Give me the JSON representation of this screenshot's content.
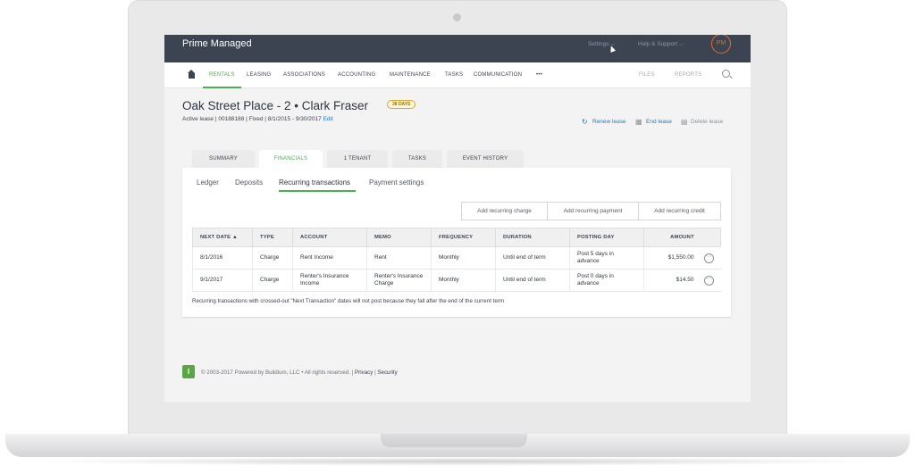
{
  "app": {
    "brand": "Prime Managed",
    "avatar_initials": "PM"
  },
  "topmenu": {
    "settings": "Settings",
    "help": "Help & Support",
    "chevron": "⌵"
  },
  "nav": {
    "items": [
      "RENTALS",
      "LEASING",
      "ASSOCIATIONS",
      "ACCOUNTING",
      "MAINTENANCE",
      "TASKS",
      "COMMUNICATION",
      "•••"
    ],
    "right": [
      "FILES",
      "REPORTS"
    ]
  },
  "lease": {
    "title": "Oak Street Place - 2 • Clark Fraser",
    "days_badge": "38 DAYS",
    "subtitle": "Active lease | 00188188 | Fixed | 8/1/2015 - 9/30/2017",
    "edit": "Edit",
    "actions": {
      "renew": "Renew lease",
      "end": "End lease",
      "delete": "Delete lease"
    }
  },
  "tabs": [
    "SUMMARY",
    "FINANCIALS",
    "1 TENANT",
    "TASKS",
    "EVENT HISTORY"
  ],
  "subtabs": [
    "Ledger",
    "Deposits",
    "Recurring transactions",
    "Payment settings"
  ],
  "buttons": {
    "charge": "Add recurring charge",
    "payment": "Add recurring payment",
    "credit": "Add recurring credit"
  },
  "table": {
    "headers": [
      "NEXT DATE ▲",
      "TYPE",
      "ACCOUNT",
      "MEMO",
      "FREQUENCY",
      "DURATION",
      "POSTING DAY",
      "AMOUNT"
    ],
    "rows": [
      {
        "next_date": "8/1/2016",
        "type": "Charge",
        "account": "Rent Income",
        "memo": "Rent",
        "frequency": "Monthly",
        "duration": "Until end of term",
        "posting_day": "Post 5 days in advance",
        "amount": "$1,550.00"
      },
      {
        "next_date": "9/1/2017",
        "type": "Charge",
        "account": "Renter's Insurance Income",
        "memo": "Renter's Insurance Charge",
        "frequency": "Monthly",
        "duration": "Until end of term",
        "posting_day": "Post 0 days in advance",
        "amount": "$14.50"
      }
    ]
  },
  "note": "Recurring transactions with crossed-out \"Next Transaction\" dates will not post because they fall after the end of the current term",
  "footer": {
    "copyright": "© 2003-2017 Powered by Buildium, LLC • All rights reserved.",
    "privacy": "Privacy",
    "security": "Security",
    "logo_letter": "l"
  },
  "icons": {
    "more": "⋯",
    "renew": "↻",
    "calendar": "▦",
    "trash": "▤"
  },
  "colors": {
    "topbar": "#3d4451",
    "accent": "#4caf50",
    "link": "#2a7ab8",
    "avatar": "#e36a2c",
    "badge": "#e0a526"
  }
}
